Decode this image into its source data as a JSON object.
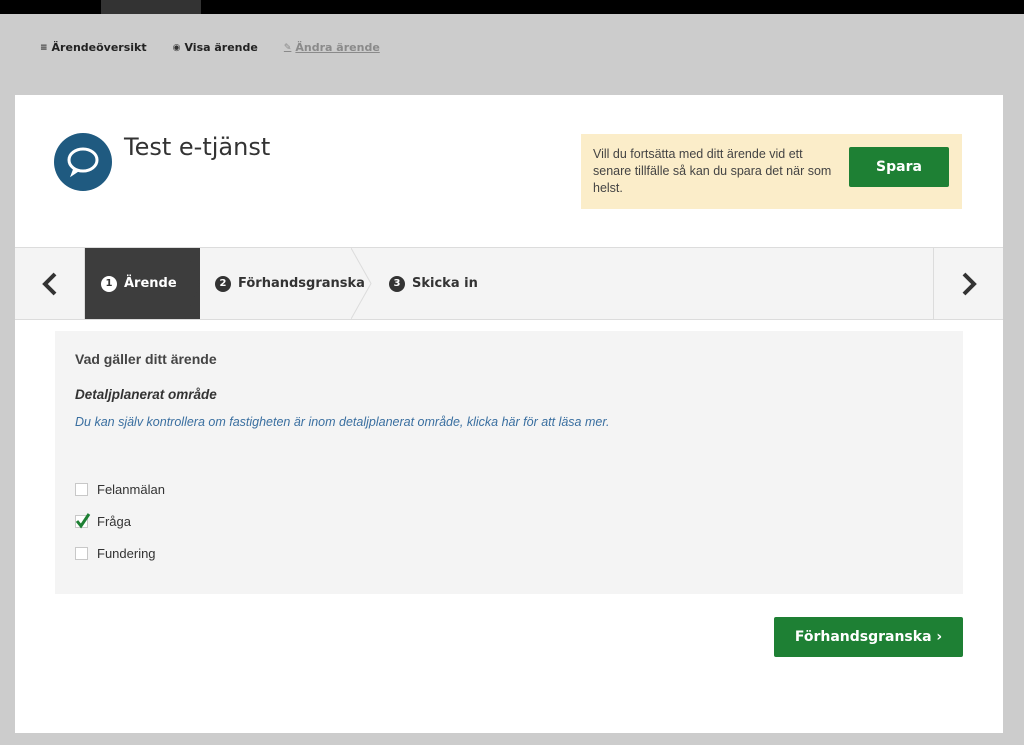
{
  "topnav": {
    "links": [
      {
        "icon": "list-icon",
        "label": "Ärendeöversikt"
      },
      {
        "icon": "eye-icon",
        "label": "Visa ärende"
      },
      {
        "icon": "pencil-icon",
        "label": "Ändra ärende"
      }
    ]
  },
  "header": {
    "logo_icon": "speech-bubble-icon",
    "title": "Test e-tjänst"
  },
  "save_notice": {
    "text": "Vill du fortsätta med ditt ärende vid ett senare tillfälle så kan du spara det när som helst.",
    "button_label": "Spara"
  },
  "steps": [
    {
      "number": "1",
      "label": "Ärende",
      "active": true
    },
    {
      "number": "2",
      "label": "Förhandsgranska",
      "active": false
    },
    {
      "number": "3",
      "label": "Skicka in",
      "active": false
    }
  ],
  "form": {
    "question": "Vad gäller ditt ärende",
    "subheading": "Detaljplanerat område",
    "help_link": "Du kan själv kontrollera om fastigheten är inom detaljplanerat område, klicka här för att läsa mer.",
    "options": [
      {
        "label": "Felanmälan",
        "checked": false
      },
      {
        "label": "Fråga",
        "checked": true
      },
      {
        "label": "Fundering",
        "checked": false
      }
    ]
  },
  "footer": {
    "next_button_label": "Förhandsgranska ›"
  },
  "colors": {
    "primary_green": "#1e8034",
    "active_step": "#3d3d3d",
    "notice_bg": "#fbedc9",
    "link_blue": "#3a6fa0",
    "logo_blue": "#1f5a80"
  }
}
